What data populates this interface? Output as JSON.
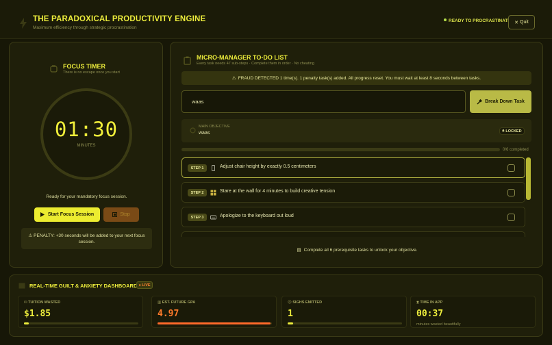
{
  "header": {
    "title": "THE PARADOXICAL PRODUCTIVITY ENGINE",
    "subtitle": "Maximum efficiency through strategic procrastination",
    "status": "READY TO PROCRASTINATE",
    "quit_label": "Quit"
  },
  "timer": {
    "title": "FOCUS TIMER",
    "subtitle": "There is no escape once you start",
    "time": "01:30",
    "unit": "MINUTES",
    "status": "Ready for your mandatory focus session.",
    "start_label": "Start Focus Session",
    "stop_label": "Stop",
    "penalty": "PENALTY: +30 seconds will be added to your next focus session."
  },
  "todo": {
    "title": "MICRO-MANAGER TO-DO LIST",
    "subtitle": "Every task needs 47 sub-steps · Complete them in order · No cheating",
    "fraud": "FRAUD DETECTED 1 time(s). 1 penalty task(s) added. All progress reset. You must wait at least 8 seconds between tasks.",
    "input_value": "waas",
    "breakdown_label": "Break Down Task",
    "objective_label": "MAIN OBJECTIVE",
    "objective_value": "waas",
    "locked_label": "LOCKED",
    "progress_text": "0/6 completed",
    "progress_fraction": 0,
    "steps": [
      {
        "badge": "STEP 1",
        "icon": "phone-icon",
        "text": "Adjust chair height by exactly 0.5 centimeters"
      },
      {
        "badge": "STEP 2",
        "icon": "grid-icon",
        "text": "Stare at the wall for 4 minutes to build creative tension"
      },
      {
        "badge": "STEP 3",
        "icon": "keyboard-icon",
        "text": "Apologize to the keyboard out loud"
      }
    ],
    "unlock_note": "Complete all 6 prerequisite tasks to unlock your objective."
  },
  "dashboard": {
    "title": "REAL-TIME GUILT & ANXIETY DASHBOARD",
    "live_label": "● LIVE",
    "cards": [
      {
        "label": "TUITION WASTED",
        "value": "$1.85",
        "color": "#ecec3c",
        "bar_color": "#ecec3c",
        "fill": 0.04
      },
      {
        "label": "EST. FUTURE GPA",
        "value": "4.97",
        "color": "#ff7a2a",
        "bar_color": "#ff6a2a",
        "fill": 0.99
      },
      {
        "label": "SIGHS EMITTED",
        "value": "1",
        "color": "#ecec3c",
        "bar_color": "#ecec3c",
        "fill": 0.05
      },
      {
        "label": "TIME IN APP",
        "value": "00:37",
        "color": "#ecec3c",
        "note": "minutes wasted beautifully"
      }
    ]
  },
  "colors": {
    "accent": "#ecec3c",
    "background": "#171707",
    "warning": "#ff7a2a"
  }
}
